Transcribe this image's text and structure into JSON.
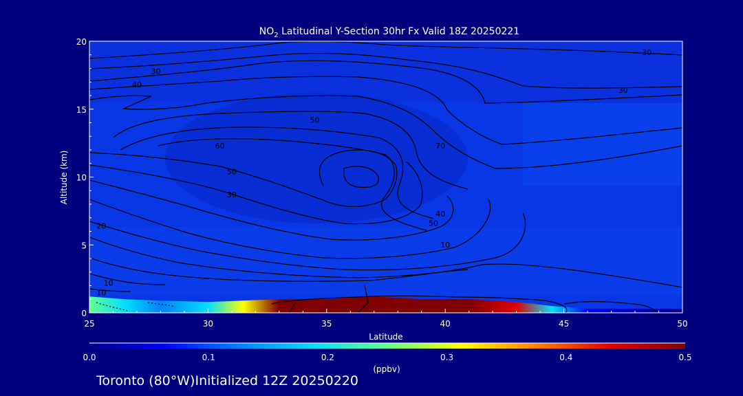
{
  "title_prefix": "NO",
  "title_sub": "2",
  "title_rest": " Latitudinal Y-Section 30hr  Fx Valid 18Z 20250221",
  "footer": "Toronto (80°W)Initialized 12Z 20250220",
  "chart_data": {
    "type": "heatmap",
    "xlabel": "Latitude",
    "ylabel": "Altitude (km)",
    "xlim": [
      25,
      50
    ],
    "ylim": [
      0,
      20
    ],
    "xticks": [
      "25",
      "30",
      "35",
      "40",
      "45",
      "50"
    ],
    "yticks": [
      "0",
      "5",
      "10",
      "15",
      "20"
    ],
    "colorbar": {
      "label": "(ppbv)",
      "range": [
        0.0,
        0.5
      ],
      "ticks": [
        "0.0",
        "0.1",
        "0.2",
        "0.3",
        "0.4",
        "0.5"
      ],
      "colors": [
        "#00008c",
        "#0000ff",
        "#0080ff",
        "#00e0ff",
        "#60ff90",
        "#ffff00",
        "#ff8000",
        "#e00000",
        "#800000"
      ]
    },
    "colors": {
      "background": "#00007e",
      "field": "#0a37e6",
      "high": "#8b0000"
    },
    "surface_layer": [
      {
        "lat": 25.0,
        "depth_km": 1.2,
        "value": 0.22
      },
      {
        "lat": 26.5,
        "depth_km": 1.0,
        "value": 0.18
      },
      {
        "lat": 28.0,
        "depth_km": 0.9,
        "value": 0.12
      },
      {
        "lat": 30.0,
        "depth_km": 0.8,
        "value": 0.16
      },
      {
        "lat": 31.5,
        "depth_km": 0.9,
        "value": 0.33
      },
      {
        "lat": 33.0,
        "depth_km": 1.0,
        "value": 0.5
      },
      {
        "lat": 35.0,
        "depth_km": 1.0,
        "value": 0.5
      },
      {
        "lat": 37.0,
        "depth_km": 1.2,
        "value": 0.5
      },
      {
        "lat": 39.0,
        "depth_km": 1.0,
        "value": 0.5
      },
      {
        "lat": 41.0,
        "depth_km": 1.0,
        "value": 0.5
      },
      {
        "lat": 43.0,
        "depth_km": 0.8,
        "value": 0.45
      },
      {
        "lat": 44.5,
        "depth_km": 0.5,
        "value": 0.2
      },
      {
        "lat": 46.0,
        "depth_km": 0.3,
        "value": 0.05
      },
      {
        "lat": 50.0,
        "depth_km": 0.3,
        "value": 0.0
      }
    ],
    "contour_labels": [
      {
        "text": "10",
        "lat": 40.0,
        "alt": 4.8
      },
      {
        "text": "10",
        "lat": 25.8,
        "alt": 2.0
      },
      {
        "text": "10",
        "lat": 25.5,
        "alt": 1.3
      },
      {
        "text": "20",
        "lat": 25.5,
        "alt": 6.2
      },
      {
        "text": "30",
        "lat": 47.5,
        "alt": 16.2
      },
      {
        "text": "30",
        "lat": 48.5,
        "alt": 19.0
      },
      {
        "text": "30",
        "lat": 31.0,
        "alt": 8.5
      },
      {
        "text": "30",
        "lat": 27.8,
        "alt": 17.6
      },
      {
        "text": "40",
        "lat": 27.0,
        "alt": 16.6
      },
      {
        "text": "50",
        "lat": 34.5,
        "alt": 14.0
      },
      {
        "text": "50",
        "lat": 31.0,
        "alt": 10.2
      },
      {
        "text": "50",
        "lat": 39.5,
        "alt": 6.4
      },
      {
        "text": "40",
        "lat": 39.8,
        "alt": 7.1
      },
      {
        "text": "60",
        "lat": 30.5,
        "alt": 12.1
      },
      {
        "text": "70",
        "lat": 39.8,
        "alt": 12.1
      }
    ]
  }
}
